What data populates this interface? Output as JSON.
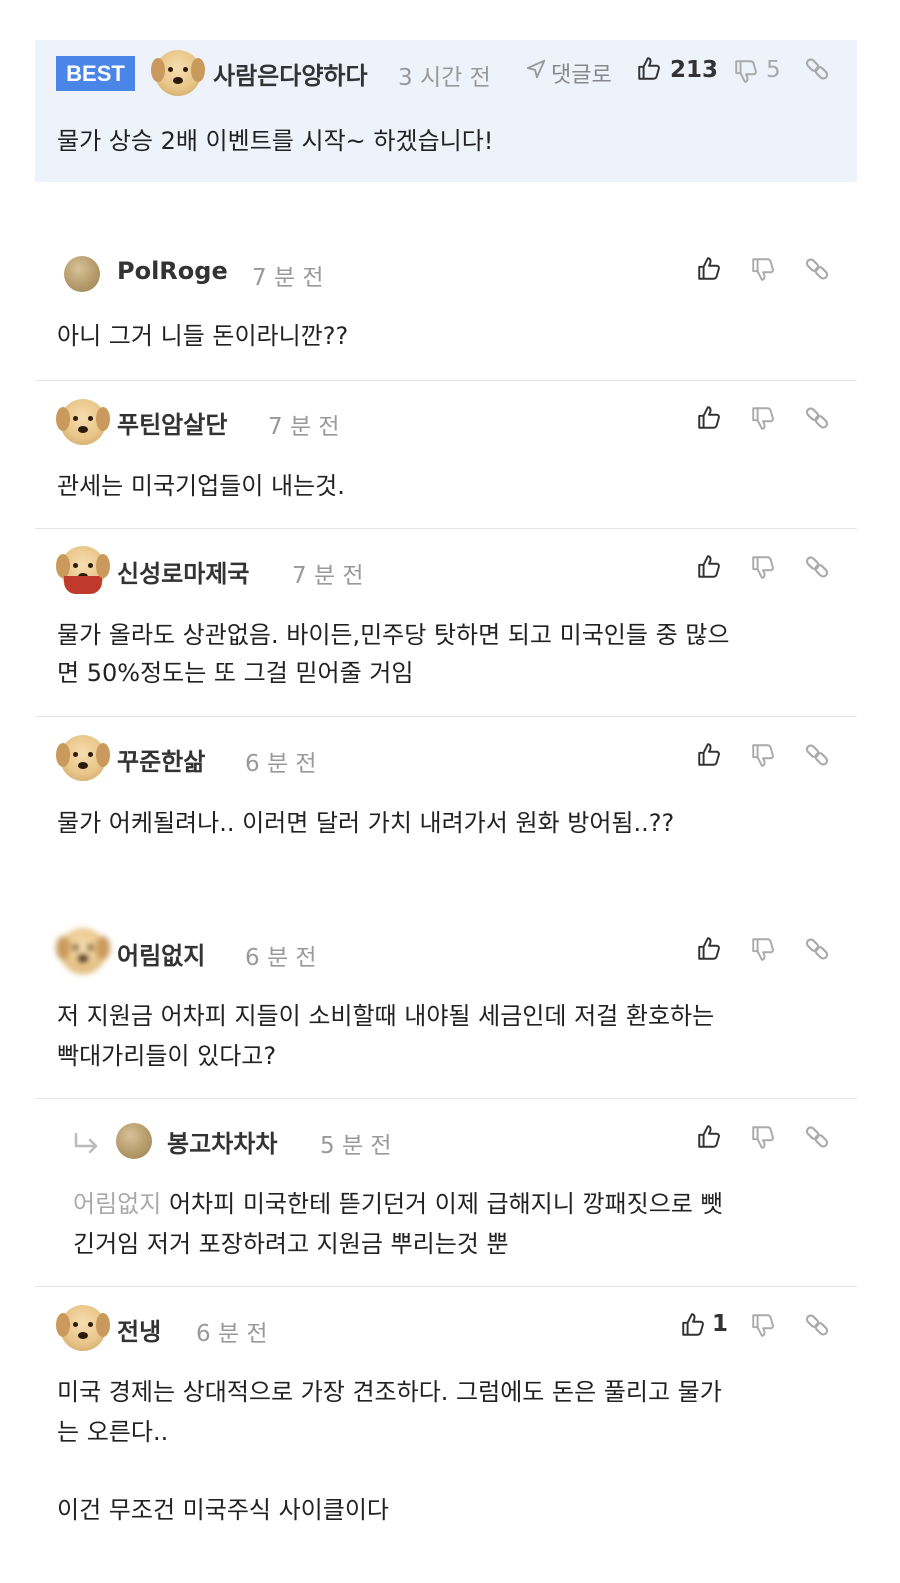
{
  "best_badge": "BEST",
  "best": {
    "author": "사람은다양하다",
    "time": "3 시간 전",
    "reply_label": "댓글로",
    "likes": "213",
    "dislikes": "5",
    "text": "물가 상승 2배 이벤트를 시작~ 하겠습니다!"
  },
  "comments": [
    {
      "author": "PolRoge",
      "time": "7 분 전",
      "lines": [
        "아니 그거 니들 돈이라니깐??"
      ]
    },
    {
      "author": "푸틴암살단",
      "time": "7 분 전",
      "lines": [
        "관세는 미국기업들이 내는것."
      ]
    },
    {
      "author": "신성로마제국",
      "time": "7 분 전",
      "lines": [
        "물가 올라도 상관없음. 바이든,민주당 탓하면 되고 미국인들 중 많으",
        "면 50%정도는 또 그걸 믿어줄 거임"
      ]
    },
    {
      "author": "꾸준한삶",
      "time": "6 분 전",
      "lines": [
        "물가 어케될려나.. 이러면 달러 가치 내려가서 원화 방어됨..??"
      ]
    },
    {
      "author": "어림없지",
      "time": "6 분 전",
      "lines": [
        "저 지원금 어차피 지들이 소비할때 내야될 세금인데 저걸 환호하는",
        "빡대가리들이 있다고?"
      ]
    },
    {
      "author": "봉고차차차",
      "time": "5 분 전",
      "reply_to": "어림없지",
      "lines": [
        "어차피 미국한테 뜯기던거 이제 급해지니 깡패짓으로 뺏",
        "긴거임 저거 포장하려고 지원금 뿌리는것 뿐"
      ]
    },
    {
      "author": "전냉",
      "time": "6 분 전",
      "likes": "1",
      "lines": [
        "미국 경제는 상대적으로 가장 견조하다. 그럼에도 돈은 풀리고 물가",
        "는 오른다..",
        "",
        "이건 무조건 미국주식 사이클이다"
      ]
    }
  ],
  "icons": {
    "like": "thumbs-up-icon",
    "dislike": "thumbs-down-icon",
    "link": "link-icon",
    "reply": "reply-arrow-icon",
    "send": "send-icon"
  },
  "colors": {
    "best_badge": "#4a86e8",
    "best_bg": "#eef2fb"
  }
}
